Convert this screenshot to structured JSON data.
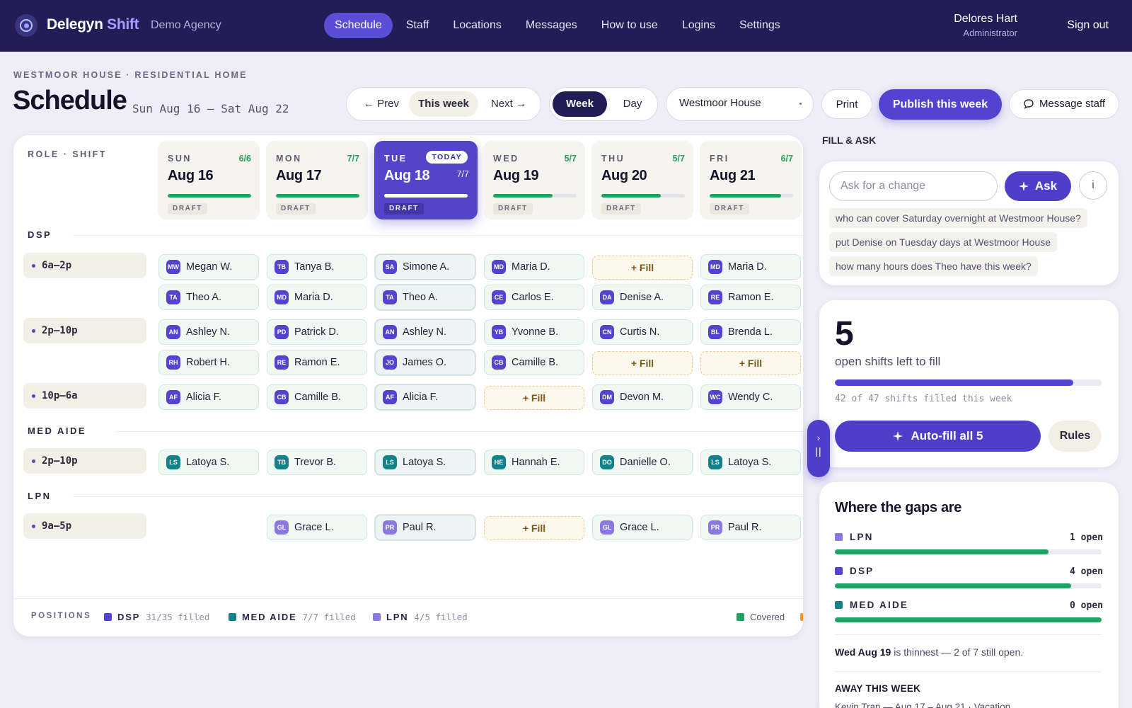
{
  "app": {
    "brand_main": "Delegyn",
    "brand_accent": "Shift",
    "agency": "Demo Agency"
  },
  "nav": [
    {
      "label": "Schedule",
      "active": true
    },
    {
      "label": "Staff"
    },
    {
      "label": "Locations"
    },
    {
      "label": "Messages"
    },
    {
      "label": "How to use"
    },
    {
      "label": "Logins"
    },
    {
      "label": "Settings"
    }
  ],
  "user": {
    "name": "Delores Hart",
    "role": "Administrator",
    "signout": "Sign out"
  },
  "header": {
    "breadcrumb": "WESTMOOR HOUSE · RESIDENTIAL HOME",
    "title": "Schedule",
    "range": "Sun Aug 16 — Sat Aug 22",
    "prev": "← Prev",
    "this_week": "This week",
    "next": "Next →",
    "view_week": "Week",
    "view_day": "Day",
    "location": "Westmoor House",
    "print": "Print",
    "publish": "Publish this week",
    "message": "Message staff"
  },
  "grid": {
    "role_header": "ROLE · SHIFT",
    "days": [
      {
        "dow": "SUN",
        "date": "Aug 16",
        "count": "6/6",
        "fill": 1.0,
        "status": "DRAFT"
      },
      {
        "dow": "MON",
        "date": "Aug 17",
        "count": "7/7",
        "fill": 1.0,
        "status": "DRAFT"
      },
      {
        "dow": "TUE",
        "date": "Aug 18",
        "count": "7/7",
        "fill": 1.0,
        "status": "DRAFT",
        "today": "TODAY"
      },
      {
        "dow": "WED",
        "date": "Aug 19",
        "count": "5/7",
        "fill": 0.714,
        "status": "DRAFT"
      },
      {
        "dow": "THU",
        "date": "Aug 20",
        "count": "5/7",
        "fill": 0.714,
        "status": "DRAFT"
      },
      {
        "dow": "FRI",
        "date": "Aug 21",
        "count": "6/7",
        "fill": 0.857,
        "status": "DRAFT"
      }
    ],
    "sections": [
      {
        "name": "DSP",
        "shifts": [
          {
            "label": "6a–2p",
            "rows": [
              [
                {
                  "ini": "MW",
                  "name": "Megan W."
                },
                {
                  "ini": "TB",
                  "name": "Tanya B."
                },
                {
                  "ini": "SA",
                  "name": "Simone A."
                },
                {
                  "ini": "MD",
                  "name": "Maria D."
                },
                {
                  "fill": "+ Fill"
                },
                {
                  "ini": "MD",
                  "name": "Maria D."
                }
              ],
              [
                {
                  "ini": "TA",
                  "name": "Theo A."
                },
                {
                  "ini": "MD",
                  "name": "Maria D."
                },
                {
                  "ini": "TA",
                  "name": "Theo A."
                },
                {
                  "ini": "CE",
                  "name": "Carlos E."
                },
                {
                  "ini": "DA",
                  "name": "Denise A."
                },
                {
                  "ini": "RE",
                  "name": "Ramon E."
                }
              ]
            ]
          },
          {
            "label": "2p–10p",
            "rows": [
              [
                {
                  "ini": "AN",
                  "name": "Ashley N."
                },
                {
                  "ini": "PD",
                  "name": "Patrick D."
                },
                {
                  "ini": "AN",
                  "name": "Ashley N."
                },
                {
                  "ini": "YB",
                  "name": "Yvonne B."
                },
                {
                  "ini": "CN",
                  "name": "Curtis N."
                },
                {
                  "ini": "BL",
                  "name": "Brenda L."
                }
              ],
              [
                {
                  "ini": "RH",
                  "name": "Robert H."
                },
                {
                  "ini": "RE",
                  "name": "Ramon E."
                },
                {
                  "ini": "JO",
                  "name": "James O."
                },
                {
                  "ini": "CB",
                  "name": "Camille B."
                },
                {
                  "fill": "+ Fill"
                },
                {
                  "fill": "+ Fill"
                }
              ]
            ]
          },
          {
            "label": "10p–6a",
            "rows": [
              [
                {
                  "ini": "AF",
                  "name": "Alicia F."
                },
                {
                  "ini": "CB",
                  "name": "Camille B."
                },
                {
                  "ini": "AF",
                  "name": "Alicia F."
                },
                {
                  "fill": "+ Fill"
                },
                {
                  "ini": "DM",
                  "name": "Devon M."
                },
                {
                  "ini": "WC",
                  "name": "Wendy C."
                }
              ]
            ]
          }
        ]
      },
      {
        "name": "MED AIDE",
        "shifts": [
          {
            "label": "2p–10p",
            "rows": [
              [
                {
                  "ini": "LS",
                  "name": "Latoya S."
                },
                {
                  "ini": "TB",
                  "name": "Trevor B."
                },
                {
                  "ini": "LS",
                  "name": "Latoya S."
                },
                {
                  "ini": "HE",
                  "name": "Hannah E."
                },
                {
                  "ini": "DO",
                  "name": "Danielle O."
                },
                {
                  "ini": "LS",
                  "name": "Latoya S."
                }
              ]
            ]
          }
        ]
      },
      {
        "name": "LPN",
        "shifts": [
          {
            "label": "9a–5p",
            "rows": [
              [
                null,
                {
                  "ini": "GL",
                  "name": "Grace L."
                },
                {
                  "ini": "PR",
                  "name": "Paul R."
                },
                {
                  "fill": "+ Fill"
                },
                {
                  "ini": "GL",
                  "name": "Grace L."
                },
                {
                  "ini": "PR",
                  "name": "Paul R."
                }
              ]
            ]
          }
        ]
      }
    ],
    "footer": {
      "positions_label": "POSITIONS",
      "items": [
        {
          "name": "DSP",
          "stat": "31/35 filled",
          "color": "#5244d0"
        },
        {
          "name": "MED AIDE",
          "stat": "7/7 filled",
          "color": "#13818a"
        },
        {
          "name": "LPN",
          "stat": "4/5 filled",
          "color": "#8a78e0"
        }
      ],
      "covered": "Covered",
      "covered_color": "#1ea45e"
    }
  },
  "avatar_colors": {
    "DSP": "#5244d0",
    "MED AIDE": "#13818a",
    "LPN": "#8a78e0"
  },
  "panel": {
    "fill_ask_label": "FILL & ASK",
    "ask_placeholder": "Ask for a change",
    "ask_button": "Ask",
    "info": "i",
    "suggestions": [
      "who can cover Saturday overnight at Westmoor House?",
      "put Denise on Tuesday days at Westmoor House",
      "how many hours does Theo have this week?"
    ],
    "open_count": "5",
    "open_label": "open shifts left to fill",
    "filled_fraction": 0.894,
    "filled_caption": "42 of 47 shifts filled this week",
    "autofill": "Auto-fill all 5",
    "rules": "Rules",
    "gaps_title": "Where the gaps are",
    "gaps": [
      {
        "name": "LPN",
        "open": "1 open",
        "fill": 0.8,
        "color": "#8a78e0"
      },
      {
        "name": "DSP",
        "open": "4 open",
        "fill": 0.886,
        "color": "#5244d0"
      },
      {
        "name": "MED AIDE",
        "open": "0 open",
        "fill": 1.0,
        "color": "#13818a"
      }
    ],
    "thinnest_bold": "Wed Aug 19",
    "thinnest_rest": " is thinnest — 2 of 7 still open.",
    "away_title": "AWAY THIS WEEK",
    "away_item": "Kevin Tran — Aug 17 – Aug 21 · Vacation"
  }
}
